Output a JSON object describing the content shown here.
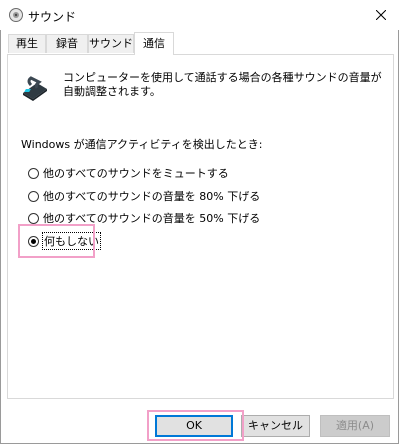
{
  "window": {
    "title": "サウンド"
  },
  "tabs": [
    {
      "label": "再生"
    },
    {
      "label": "録音"
    },
    {
      "label": "サウンド"
    },
    {
      "label": "通信",
      "active": true
    }
  ],
  "communications": {
    "description": "コンピューターを使用して通話する場合の各種サウンドの音量が自動調整されます。",
    "detect_label": "Windows が通信アクティビティを検出したとき:",
    "options": [
      {
        "label": "他のすべてのサウンドをミュートする",
        "checked": false
      },
      {
        "label": "他のすべてのサウンドの音量を 80% 下げる",
        "checked": false
      },
      {
        "label": "他のすべてのサウンドの音量を 50% 下げる",
        "checked": false
      },
      {
        "label": "何もしない",
        "checked": true
      }
    ]
  },
  "buttons": {
    "ok": "OK",
    "cancel": "キャンセル",
    "apply": "適用(A)"
  },
  "colors": {
    "highlight": "#f2a0c8",
    "focus_border": "#0078d7"
  }
}
